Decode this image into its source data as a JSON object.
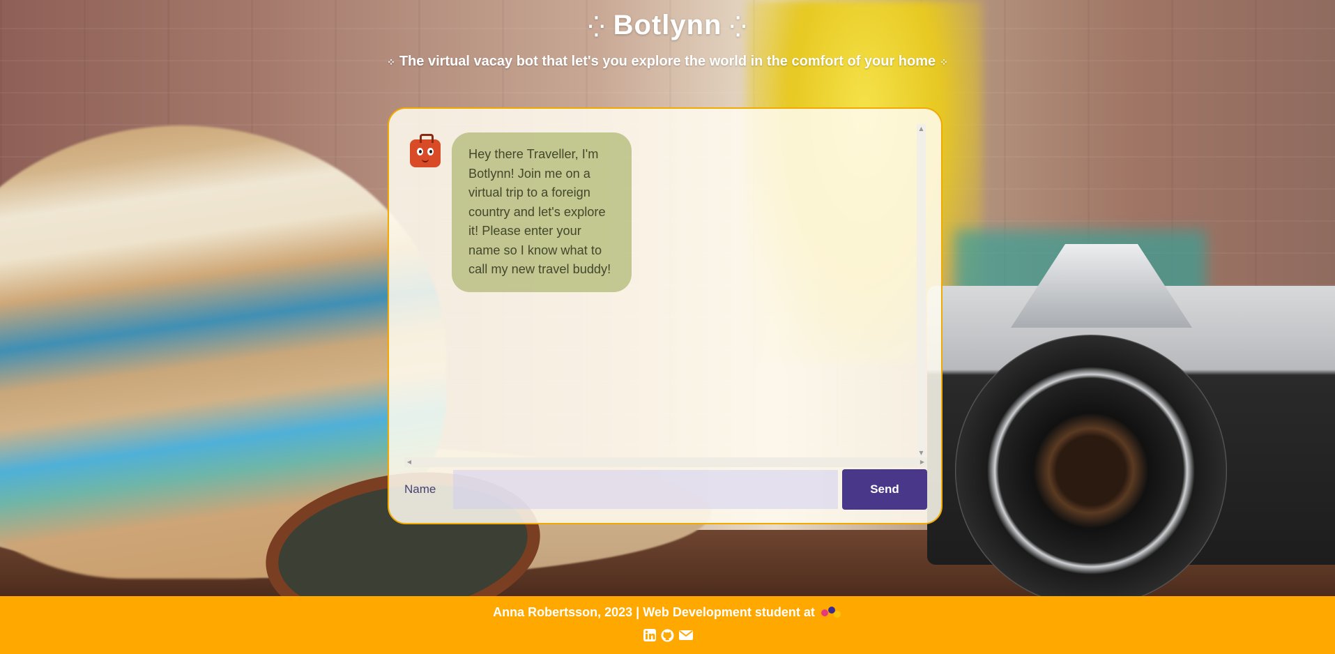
{
  "header": {
    "title": "Botlynn",
    "subtitle": "The virtual vacay bot that let's you explore the world in the comfort of your home"
  },
  "chat": {
    "messages": [
      {
        "sender": "bot",
        "text": "Hey there Traveller, I'm Botlynn! Join me on a virtual trip to a foreign country and let's explore it! Please enter your name so I know what to call my new travel buddy!"
      }
    ],
    "input": {
      "label": "Name",
      "value": "",
      "placeholder": ""
    },
    "send_label": "Send"
  },
  "footer": {
    "text": "Anna Robertsson, 2023 | Web Development student at",
    "icons": [
      "linkedin-icon",
      "github-icon",
      "email-icon"
    ]
  },
  "colors": {
    "accent": "#ffa800",
    "button": "#493889",
    "bubble": "#aeb770"
  }
}
